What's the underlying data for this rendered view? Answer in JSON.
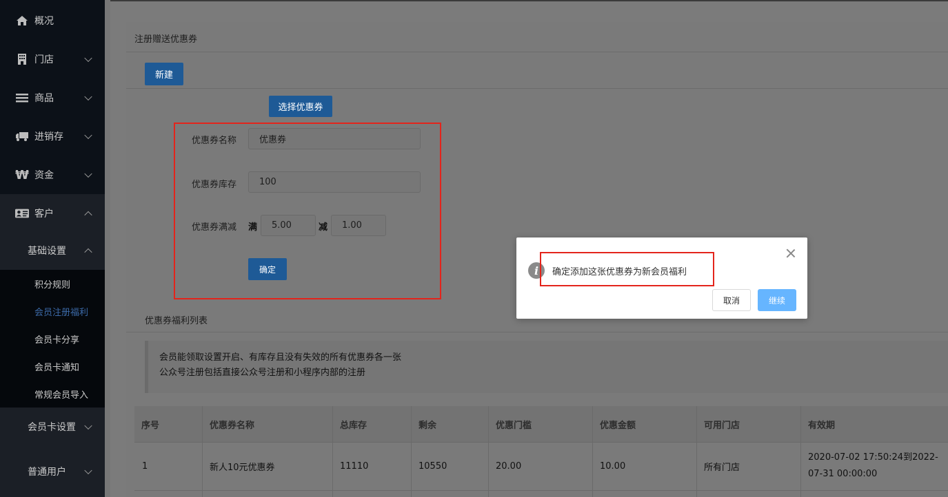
{
  "sidebar": {
    "items": [
      {
        "label": "概况",
        "icon": "home-icon"
      },
      {
        "label": "门店",
        "icon": "building-icon"
      },
      {
        "label": "商品",
        "icon": "list-icon"
      },
      {
        "label": "进销存",
        "icon": "truck-icon"
      },
      {
        "label": "资金",
        "icon": "won-icon"
      },
      {
        "label": "客户",
        "icon": "id-card-icon"
      }
    ],
    "sub_basic": "基础设置",
    "leaves": [
      "积分规则",
      "会员注册福利",
      "会员卡分享",
      "会员卡通知",
      "常规会员导入"
    ],
    "sub_card_settings": "会员卡设置",
    "sub_normal_users": "普通用户"
  },
  "page": {
    "title": "注册赠送优惠券",
    "new_button": "新建",
    "select_coupon_button": "选择优惠券"
  },
  "form": {
    "name_label": "优惠券名称",
    "name_value": "优惠券",
    "stock_label": "优惠券库存",
    "stock_value": "100",
    "threshold_label": "优惠券满减",
    "full_label": "满",
    "full_value": "5.00",
    "minus_label": "减",
    "minus_value": "1.00",
    "confirm_button": "确定"
  },
  "list": {
    "title": "优惠券福利列表",
    "note_line1": "会员能领取设置开启、有库存且没有失效的所有优惠券各一张",
    "note_line2": "公众号注册包括直接公众号注册和小程序内部的注册",
    "headers": [
      "序号",
      "优惠券名称",
      "总库存",
      "剩余",
      "优惠门槛",
      "优惠金额",
      "可用门店",
      "有效期"
    ],
    "rows": [
      [
        "1",
        "新人10元优惠券",
        "11110",
        "10550",
        "20.00",
        "10.00",
        "所有门店",
        "2020-07-02 17:50:24到2022-07-31 00:00:00"
      ]
    ]
  },
  "dialog": {
    "message": "确定添加这张优惠券为新会员福利",
    "cancel": "取消",
    "continue": "继续",
    "icon": "info-icon"
  },
  "colors": {
    "highlight": "#e3241b",
    "primary_button": "#1e5a96",
    "continue_button": "#66b5ff",
    "active_leaf": "#3c6aa8"
  }
}
